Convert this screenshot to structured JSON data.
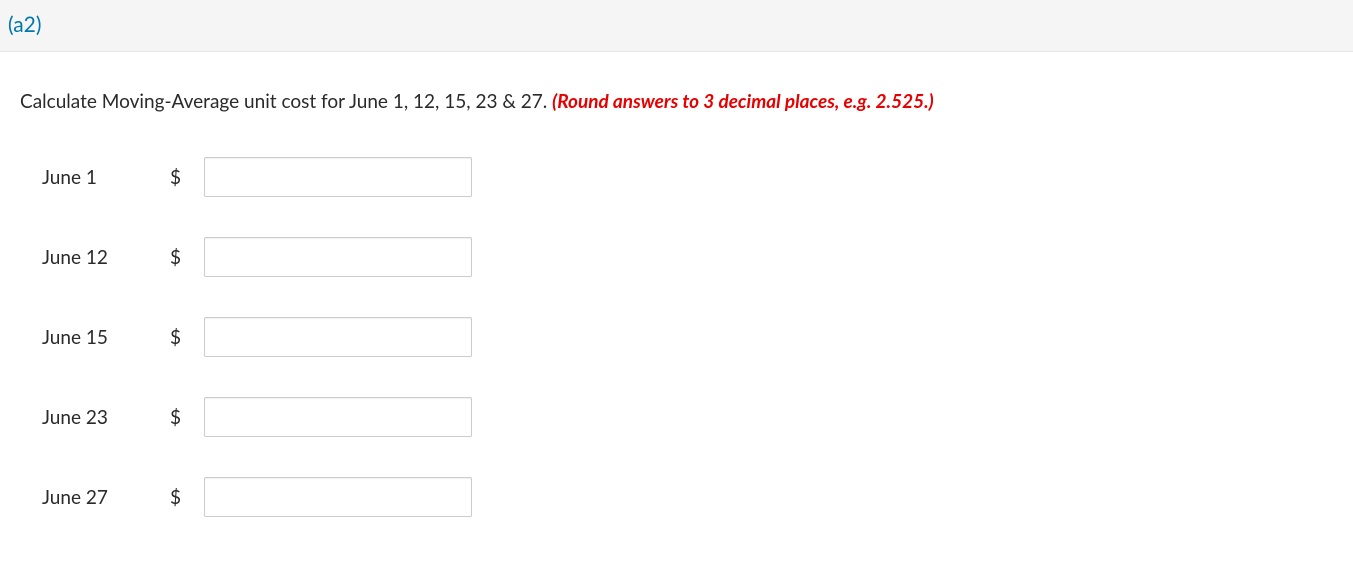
{
  "header": {
    "label": "(a2)"
  },
  "instruction": {
    "text": "Calculate Moving-Average unit cost for June 1, 12, 15, 23 & 27. ",
    "hint": "(Round answers to 3 decimal places, e.g. 2.525.)"
  },
  "rows": [
    {
      "label": "June 1",
      "currency": "$",
      "value": ""
    },
    {
      "label": "June 12",
      "currency": "$",
      "value": ""
    },
    {
      "label": "June 15",
      "currency": "$",
      "value": ""
    },
    {
      "label": "June 23",
      "currency": "$",
      "value": ""
    },
    {
      "label": "June 27",
      "currency": "$",
      "value": ""
    }
  ]
}
